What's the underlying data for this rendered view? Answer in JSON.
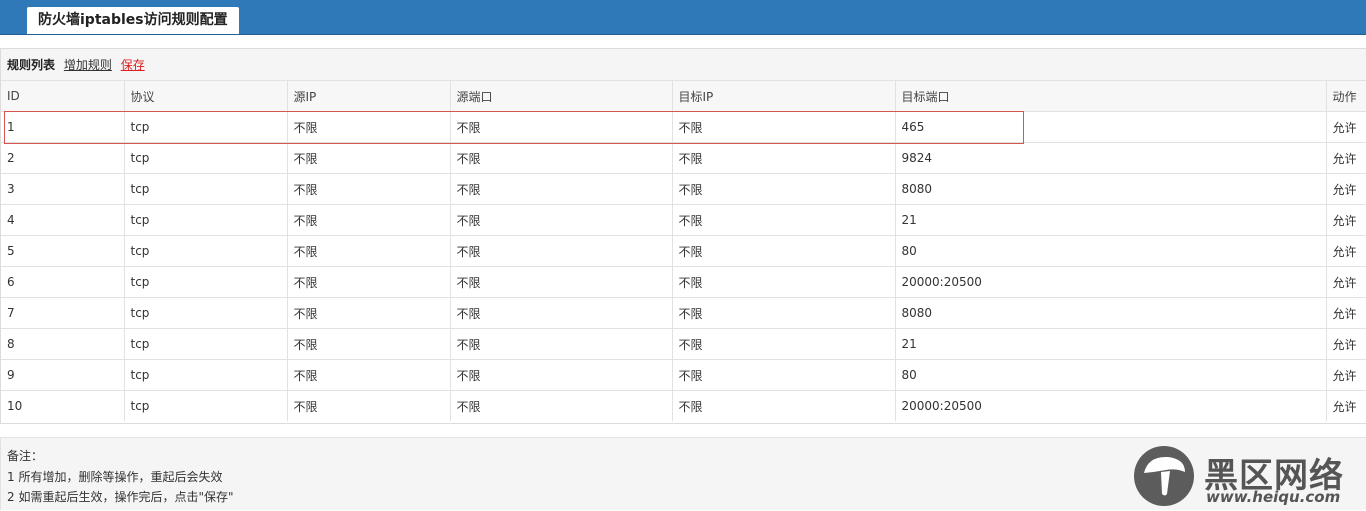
{
  "header": {
    "active_tab": "防火墙iptables访问规则配置",
    "bar_color": "#2f79b9"
  },
  "toolbar": {
    "title": "规则列表",
    "add_label": "增加规则",
    "save_label": "保存",
    "save_color": "#e02020"
  },
  "table": {
    "columns": [
      "ID",
      "协议",
      "源IP",
      "源端口",
      "目标IP",
      "目标端口",
      "动作"
    ],
    "rows": [
      [
        "1",
        "tcp",
        "不限",
        "不限",
        "不限",
        "465",
        "允许"
      ],
      [
        "2",
        "tcp",
        "不限",
        "不限",
        "不限",
        "9824",
        "允许"
      ],
      [
        "3",
        "tcp",
        "不限",
        "不限",
        "不限",
        "8080",
        "允许"
      ],
      [
        "4",
        "tcp",
        "不限",
        "不限",
        "不限",
        "21",
        "允许"
      ],
      [
        "5",
        "tcp",
        "不限",
        "不限",
        "不限",
        "80",
        "允许"
      ],
      [
        "6",
        "tcp",
        "不限",
        "不限",
        "不限",
        "20000:20500",
        "允许"
      ],
      [
        "7",
        "tcp",
        "不限",
        "不限",
        "不限",
        "8080",
        "允许"
      ],
      [
        "8",
        "tcp",
        "不限",
        "不限",
        "不限",
        "21",
        "允许"
      ],
      [
        "9",
        "tcp",
        "不限",
        "不限",
        "不限",
        "80",
        "允许"
      ],
      [
        "10",
        "tcp",
        "不限",
        "不限",
        "不限",
        "20000:20500",
        "允许"
      ]
    ],
    "highlight_color": "#d9534f"
  },
  "notes": {
    "heading": "备注：",
    "items": [
      "1 所有增加，删除等操作，重起后会失效",
      "2 如需重起后生效，操作完后，点击\"保存\""
    ]
  },
  "watermark": {
    "icon": "mushroom-logo-icon",
    "name": "黑区网络",
    "url": "www.heiqu.com"
  }
}
